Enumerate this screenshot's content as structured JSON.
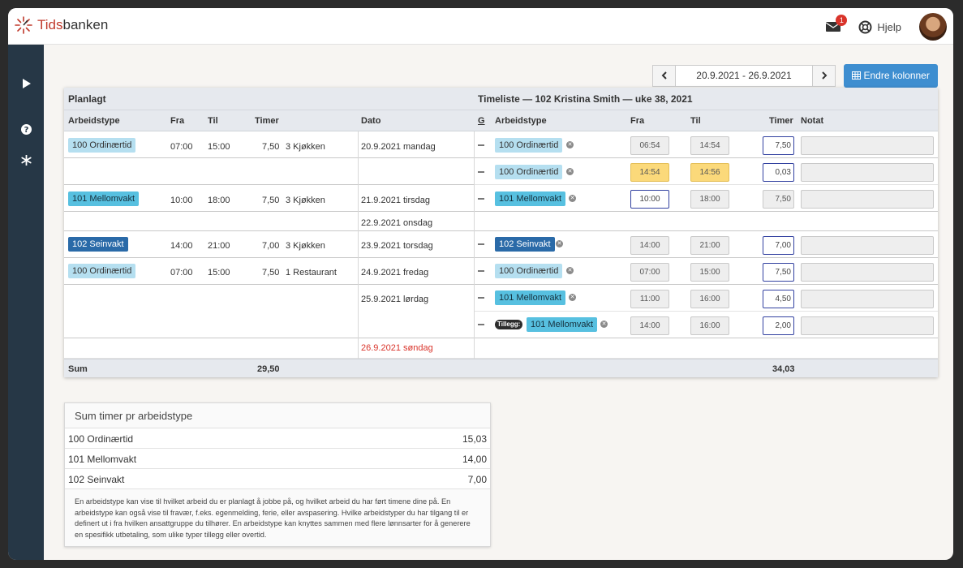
{
  "app": {
    "logo_prefix": "Tids",
    "logo_suffix": "banken"
  },
  "top": {
    "mail_badge": "1",
    "help_label": "Hjelp"
  },
  "toolbar": {
    "date_range": "20.9.2021 - 26.9.2021",
    "prev_label": "‹",
    "next_label": "›",
    "columns_button": "Endre kolonner"
  },
  "table": {
    "planned_title": "Planlagt",
    "timesheet_title": "Timeliste — 102 Kristina Smith — uke 38, 2021",
    "planned_cols": {
      "type": "Arbeidstype",
      "from": "Fra",
      "to": "Til",
      "hours": "Timer",
      "date": "Dato"
    },
    "sheet_cols": {
      "g": "G",
      "type": "Arbeidstype",
      "from": "Fra",
      "to": "Til",
      "hours": "Timer",
      "note": "Notat"
    },
    "planned_rows": [
      {
        "type": "100 Ordinærtid",
        "kind": "ord",
        "from": "07:00",
        "to": "15:00",
        "hours": "7,50",
        "place": "3 Kjøkken",
        "date": "20.9.2021 mandag"
      },
      {
        "type": "101 Mellomvakt",
        "kind": "mel",
        "from": "10:00",
        "to": "18:00",
        "hours": "7,50",
        "place": "3 Kjøkken",
        "date": "21.9.2021 tirsdag"
      },
      {
        "date": "22.9.2021 onsdag"
      },
      {
        "type": "102 Seinvakt",
        "kind": "sei",
        "from": "14:00",
        "to": "21:00",
        "hours": "7,00",
        "place": "3 Kjøkken",
        "date": "23.9.2021 torsdag"
      },
      {
        "type": "100 Ordinærtid",
        "kind": "ord",
        "from": "07:00",
        "to": "15:00",
        "hours": "7,50",
        "place": "1 Restaurant",
        "date": "24.9.2021 fredag"
      },
      {
        "date": "25.9.2021 lørdag"
      },
      {
        "date": "26.9.2021 søndag"
      }
    ],
    "sheet_rows": [
      {
        "type": "100 Ordinærtid",
        "from": "06:54",
        "to": "14:54",
        "hours": "7,50"
      },
      {
        "type": "100 Ordinærtid",
        "from": "14:54",
        "to": "14:56",
        "hours": "0,03"
      },
      {
        "type": "101 Mellomvakt",
        "from": "10:00",
        "to": "18:00",
        "hours": "7,50"
      },
      {
        "type": "102 Seinvakt",
        "from": "14:00",
        "to": "21:00",
        "hours": "7,00"
      },
      {
        "type": "100 Ordinærtid",
        "from": "07:00",
        "to": "15:00",
        "hours": "7,50"
      },
      {
        "type": "101 Mellomvakt",
        "from": "11:00",
        "to": "16:00",
        "hours": "4,50"
      },
      {
        "tag": "Tillegg:",
        "type": "101 Mellomvakt",
        "from": "14:00",
        "to": "16:00",
        "hours": "2,00"
      }
    ],
    "sum_label": "Sum",
    "sum_planned": "29,50",
    "sum_sheet": "34,03"
  },
  "summary": {
    "title": "Sum timer pr arbeidstype",
    "rows": [
      {
        "name": "100 Ordinærtid",
        "value": "15,03"
      },
      {
        "name": "101 Mellomvakt",
        "value": "14,00"
      },
      {
        "name": "102 Seinvakt",
        "value": "7,00"
      }
    ],
    "description": "En arbeidstype kan vise til hvilket arbeid du er planlagt å jobbe på, og hvilket arbeid du har ført timene dine på. En arbeidstype kan også vise til fravær, f.eks. egenmelding, ferie, eller avspasering. Hvilke arbeidstyper du har tilgang til er definert ut i fra hvilken ansattgruppe du tilhører. En arbeidstype kan knyttes sammen med flere lønnsarter for å generere en spesifikk utbetaling, som ulike typer tillegg eller overtid."
  },
  "colors": {
    "sidebar": "#263746",
    "accent": "#3e8ed0",
    "ordinaer": "#b5dff0",
    "mellomvakt": "#57c0e0",
    "seinvakt": "#2a6aa8",
    "highlight": "#fbd97a",
    "sunday": "#d9342b"
  }
}
